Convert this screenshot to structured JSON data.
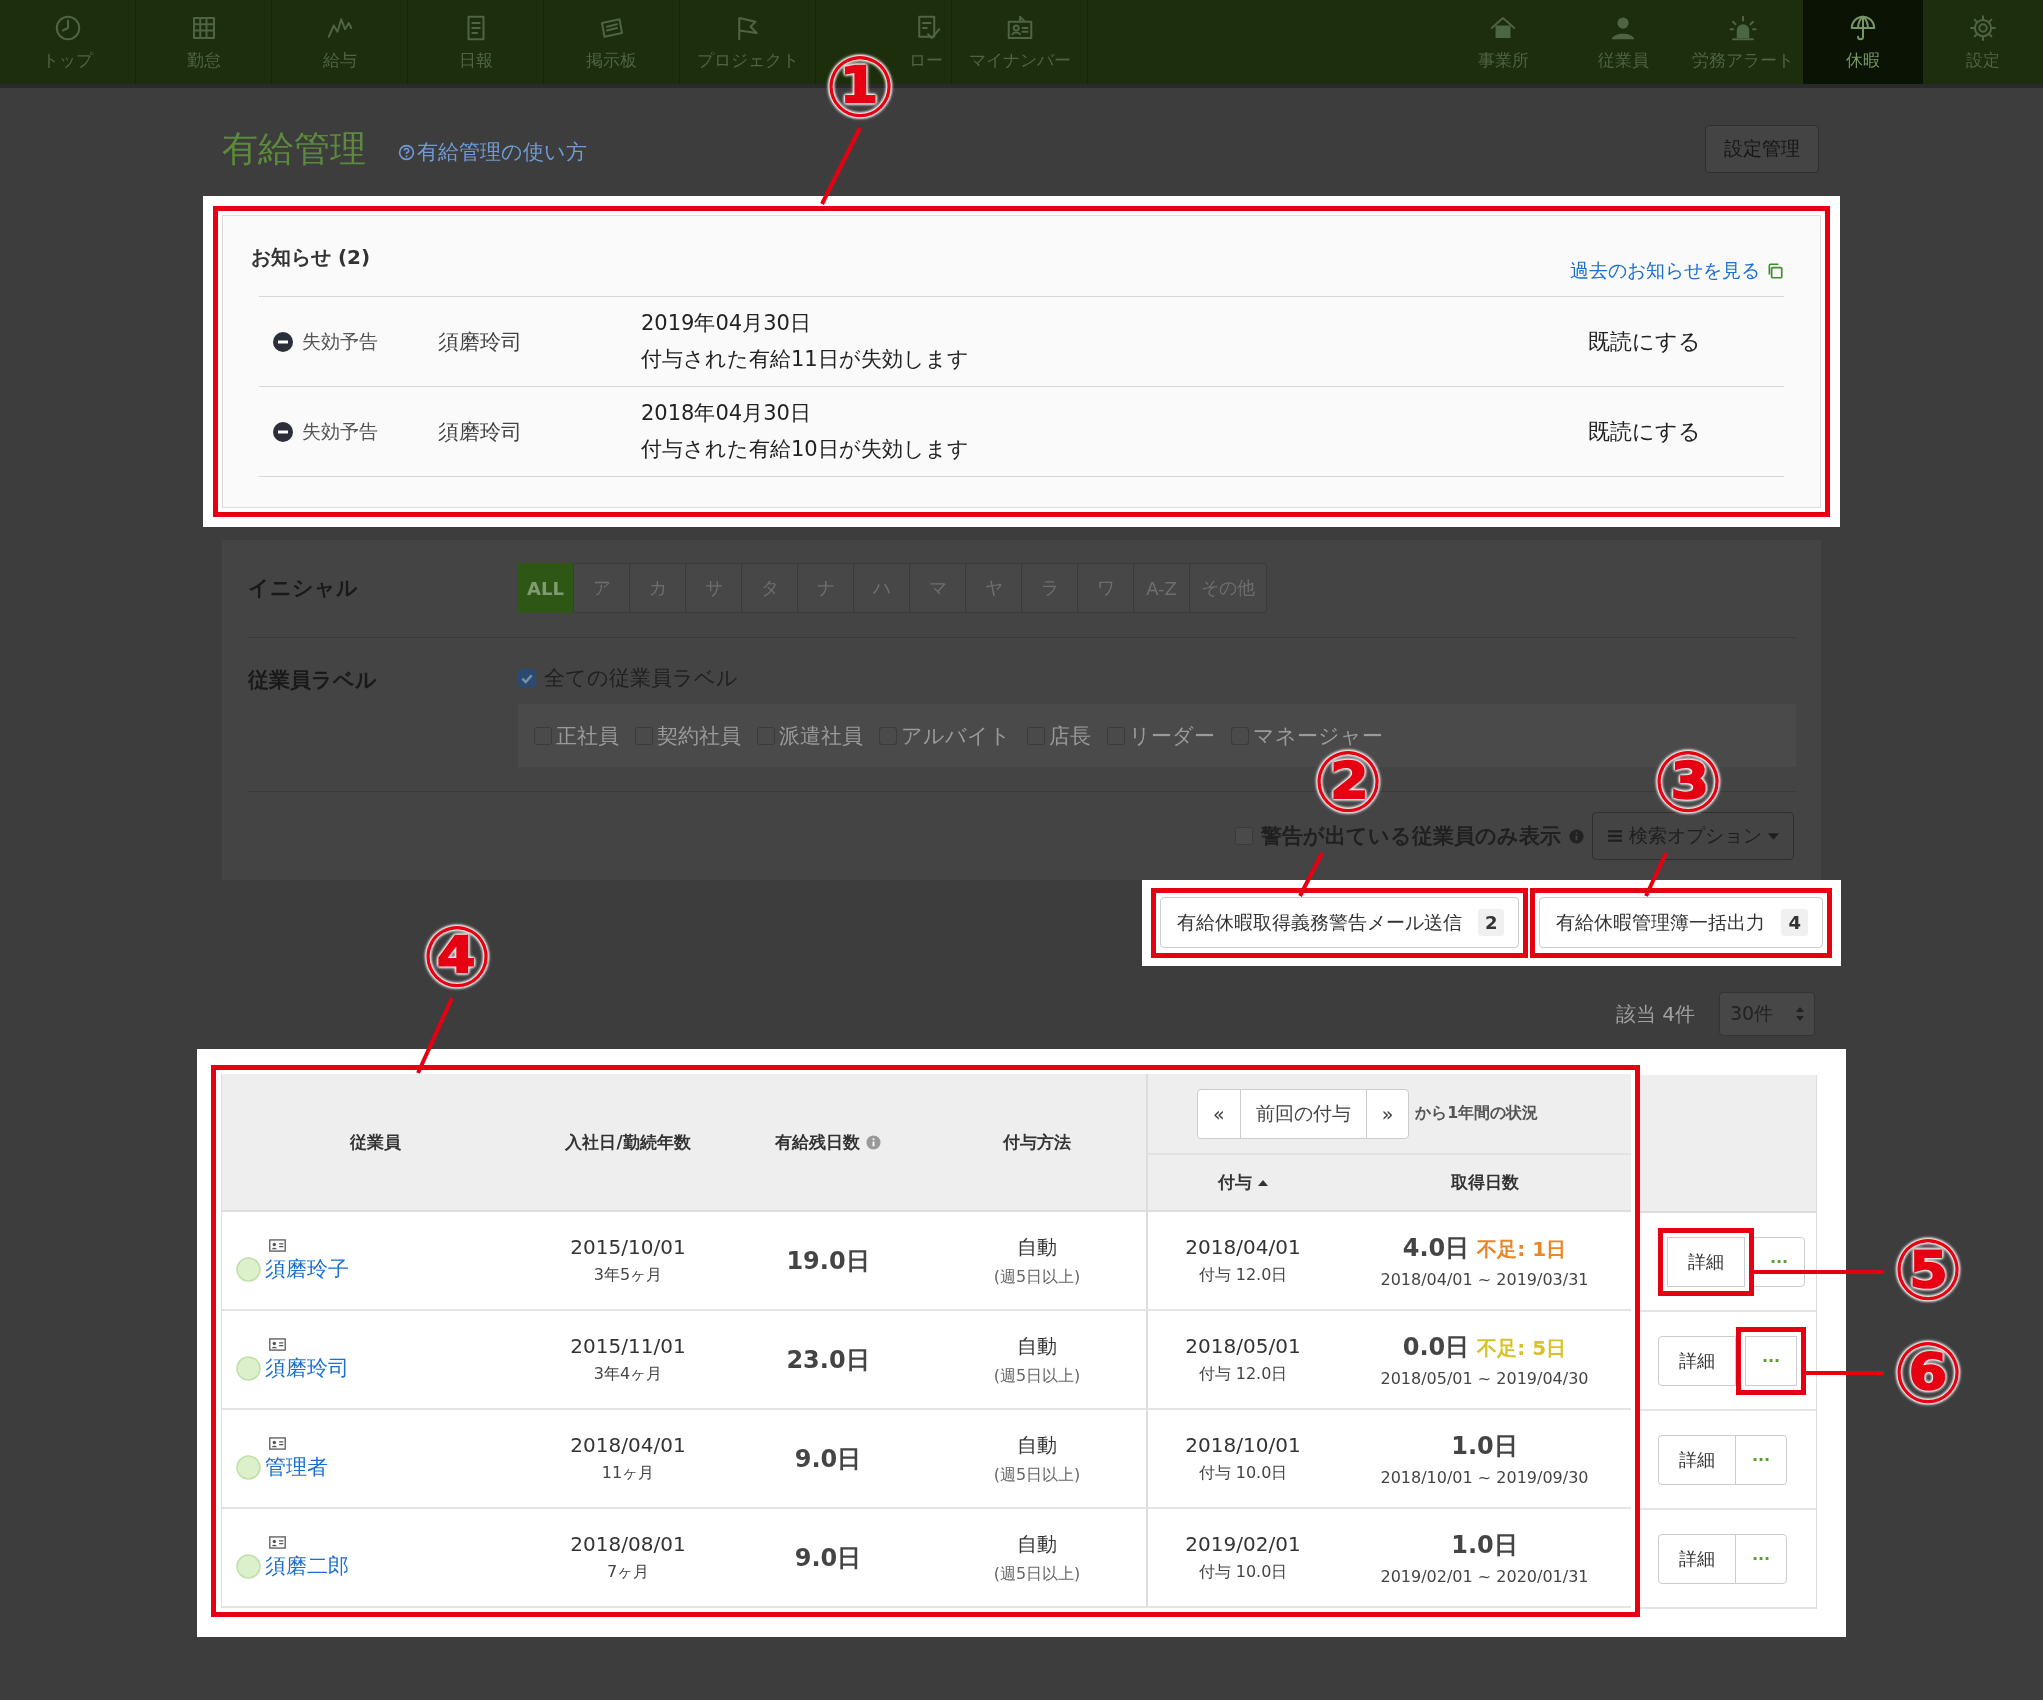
{
  "nav": {
    "left": [
      {
        "label": "トップ",
        "selected": false
      },
      {
        "label": "勤怠",
        "selected": false
      },
      {
        "label": "給与",
        "selected": false
      },
      {
        "label": "日報",
        "selected": false
      },
      {
        "label": "掲示板",
        "selected": false
      },
      {
        "label": "プロジェクト",
        "selected": false
      },
      {
        "label": "ロー",
        "selected": false
      },
      {
        "label": "マイナンバー",
        "selected": false
      }
    ],
    "right": [
      {
        "label": "事業所",
        "selected": false
      },
      {
        "label": "従業員",
        "selected": false
      },
      {
        "label": "労務アラート",
        "selected": false
      },
      {
        "label": "休暇",
        "selected": true
      },
      {
        "label": "設定",
        "selected": false
      }
    ]
  },
  "page": {
    "title": "有給管理",
    "help_link": "有給管理の使い方",
    "settings_button": "設定管理"
  },
  "notices": {
    "title": "お知らせ (2)",
    "past_link": "過去のお知らせを見る",
    "items": [
      {
        "type": "失効予告",
        "employee": "須磨玲司",
        "date": "2019年04月30日",
        "message": "付与された有給11日が失効します",
        "action": "既読にする"
      },
      {
        "type": "失効予告",
        "employee": "須磨玲司",
        "date": "2018年04月30日",
        "message": "付与された有給10日が失効します",
        "action": "既読にする"
      }
    ]
  },
  "filters": {
    "initial_label": "イニシャル",
    "initials": [
      {
        "label": "ALL",
        "selected": true
      },
      {
        "label": "ア",
        "selected": false
      },
      {
        "label": "カ",
        "selected": false
      },
      {
        "label": "サ",
        "selected": false
      },
      {
        "label": "タ",
        "selected": false
      },
      {
        "label": "ナ",
        "selected": false
      },
      {
        "label": "ハ",
        "selected": false
      },
      {
        "label": "マ",
        "selected": false
      },
      {
        "label": "ヤ",
        "selected": false
      },
      {
        "label": "ラ",
        "selected": false
      },
      {
        "label": "ワ",
        "selected": false
      },
      {
        "label": "A-Z",
        "selected": false
      },
      {
        "label": "その他",
        "selected": false
      }
    ],
    "label_title": "従業員ラベル",
    "all_labels": {
      "label": "全ての従業員ラベル",
      "checked": true
    },
    "labels": [
      {
        "label": "正社員",
        "checked": false
      },
      {
        "label": "契約社員",
        "checked": false
      },
      {
        "label": "派遣社員",
        "checked": false
      },
      {
        "label": "アルバイト",
        "checked": false
      },
      {
        "label": "店長",
        "checked": false
      },
      {
        "label": "リーダー",
        "checked": false
      },
      {
        "label": "マネージャー",
        "checked": false
      }
    ],
    "warning_only": {
      "label": "警告が出ている従業員のみ表示",
      "checked": false
    },
    "search_options": "検索オプション"
  },
  "actions": [
    {
      "label": "有給休暇取得義務警告メール送信",
      "count": "2"
    },
    {
      "label": "有給休暇管理簿一括出力",
      "count": "4"
    }
  ],
  "result": {
    "count": "該当 4件",
    "page_size": "30件"
  },
  "table": {
    "columns": [
      "従業員",
      "入社日/勤続年数",
      "有給残日数",
      "付与方法"
    ],
    "pager": {
      "prev": "«",
      "current": "前回の付与",
      "next": "»",
      "suffix": "から1年間の状況"
    },
    "sub_columns": [
      {
        "label": "付与",
        "sorted": true
      },
      {
        "label": "取得日数",
        "sorted": false
      }
    ],
    "rows": [
      {
        "name": "須磨玲子",
        "hire_date": "2015/10/01",
        "tenure": "3年5ヶ月",
        "remaining": "19.0日",
        "method": "自動",
        "method_note": "(週5日以上)",
        "grant_date": "2018/04/01",
        "grant_amount": "付与 12.0日",
        "taken": "4.0日",
        "shortage": {
          "text": "不足: 1日",
          "color": "#e8862a"
        },
        "period": "2018/04/01 ~ 2019/03/31",
        "detail": "詳細",
        "more": "···",
        "detail_highlighted": true,
        "more_highlighted": false
      },
      {
        "name": "須磨玲司",
        "hire_date": "2015/11/01",
        "tenure": "3年4ヶ月",
        "remaining": "23.0日",
        "method": "自動",
        "method_note": "(週5日以上)",
        "grant_date": "2018/05/01",
        "grant_amount": "付与 12.0日",
        "taken": "0.0日",
        "shortage": {
          "text": "不足: 5日",
          "color": "#d8c22a"
        },
        "period": "2018/05/01 ~ 2019/04/30",
        "detail": "詳細",
        "more": "···",
        "detail_highlighted": false,
        "more_highlighted": true
      },
      {
        "name": "管理者",
        "hire_date": "2018/04/01",
        "tenure": "11ヶ月",
        "remaining": "9.0日",
        "method": "自動",
        "method_note": "(週5日以上)",
        "grant_date": "2018/10/01",
        "grant_amount": "付与 10.0日",
        "taken": "1.0日",
        "period": "2018/10/01 ~ 2019/09/30",
        "detail": "詳細",
        "more": "···",
        "detail_highlighted": false,
        "more_highlighted": false
      },
      {
        "name": "須磨二郎",
        "hire_date": "2018/08/01",
        "tenure": "7ヶ月",
        "remaining": "9.0日",
        "method": "自動",
        "method_note": "(週5日以上)",
        "grant_date": "2019/02/01",
        "grant_amount": "付与 10.0日",
        "taken": "1.0日",
        "period": "2019/02/01 ~ 2020/01/31",
        "detail": "詳細",
        "more": "···",
        "detail_highlighted": false,
        "more_highlighted": false
      }
    ]
  },
  "callouts": [
    {
      "label": "①"
    },
    {
      "label": "②"
    },
    {
      "label": "③"
    },
    {
      "label": "④"
    },
    {
      "label": "⑤"
    },
    {
      "label": "⑥"
    }
  ]
}
